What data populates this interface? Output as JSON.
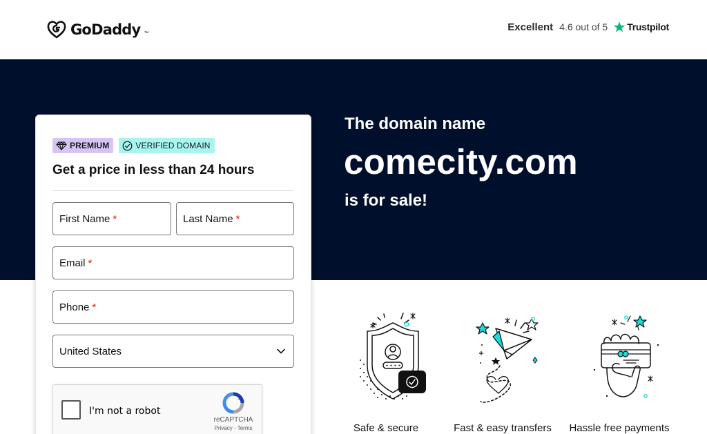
{
  "header": {
    "logo_text": "GoDaddy",
    "logo_tm": "™",
    "rating_label": "Excellent",
    "rating_score": "4.6 out of 5",
    "trustpilot_label": "Trustpilot"
  },
  "hero": {
    "lead": "The domain name",
    "domain": "comecity.com",
    "sale": "is for sale!"
  },
  "form": {
    "badge_premium": "PREMIUM",
    "badge_verified": "VERIFIED DOMAIN",
    "title": "Get a price in less than 24 hours",
    "first_name": "First Name",
    "last_name": "Last Name",
    "email": "Email",
    "phone": "Phone",
    "required_mark": "*",
    "country": "United States",
    "captcha_label": "I'm not a robot",
    "captcha_brand": "reCAPTCHA",
    "captcha_links": "Privacy - Terms"
  },
  "features": [
    {
      "label": "Safe & secure",
      "icon": "shield-icon"
    },
    {
      "label": "Fast & easy transfers",
      "icon": "paper-plane-icon"
    },
    {
      "label": "Hassle free payments",
      "icon": "card-hand-icon"
    }
  ],
  "colors": {
    "hero_bg": "#000f2c",
    "accent_teal": "#1bdbdb",
    "premium_bg": "#d6c4f5",
    "verified_bg": "#a8f4ef",
    "required": "#db1802",
    "trustpilot_green": "#00b67a"
  }
}
